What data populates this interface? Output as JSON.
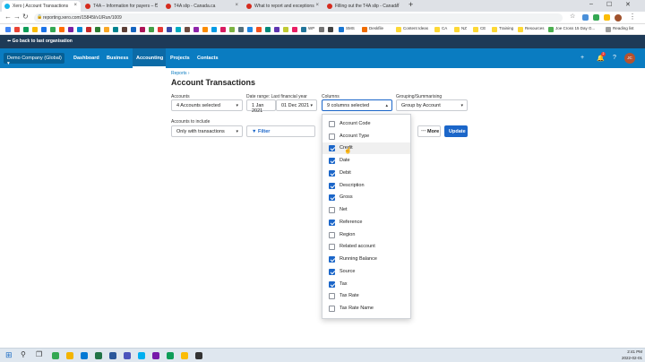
{
  "browser": {
    "tabs": [
      {
        "label": "Xero | Account Transactions",
        "active": true,
        "color": "#13b5ea"
      },
      {
        "label": "T4A – Information for payers – C",
        "active": false,
        "color": "#d52b1e"
      },
      {
        "label": "T4A slip - Canada.ca",
        "active": false,
        "color": "#d52b1e"
      },
      {
        "label": "What to report and exceptions",
        "active": false,
        "color": "#d52b1e"
      },
      {
        "label": "Filling out the T4A slip - Canada",
        "active": false,
        "color": "#d52b1e"
      }
    ],
    "new_tab": "+",
    "url": "reporting.xero.com/15845l/v1/Run/1009",
    "bookmarks": [
      "WP",
      "SMS",
      "Deskfile",
      "Content Ideas",
      "CA",
      "NZ",
      "CE",
      "Training",
      "Resources",
      "Joe Cross 15 Day G...",
      "Reading list"
    ]
  },
  "xero": {
    "back_link": "Go back to last organisation",
    "org_name": "Demo Company (Global)",
    "nav": [
      "Dashboard",
      "Business",
      "Accounting",
      "Projects",
      "Contacts"
    ],
    "avatar_text": "JC",
    "notif_count": "2"
  },
  "page": {
    "breadcrumb": "Reports ›",
    "title": "Account Transactions",
    "accounts_label": "Accounts",
    "accounts_value": "4 Accounts selected",
    "date_label": "Date range: Last financial year",
    "date_from": "1 Jan 2021",
    "date_to": "01 Dec 2021",
    "columns_label": "Columns",
    "columns_value": "9 columns selected",
    "grouping_label": "Grouping/Summarising",
    "grouping_value": "Group by Account",
    "include_label": "Accounts to include",
    "include_value": "Only with transactions",
    "filter_label": "Filter",
    "more_label": "More",
    "update_label": "Update"
  },
  "columns_options": [
    {
      "label": "Account Code",
      "checked": false
    },
    {
      "label": "Account Type",
      "checked": false
    },
    {
      "label": "Credit",
      "checked": true
    },
    {
      "label": "Date",
      "checked": true
    },
    {
      "label": "Debit",
      "checked": true
    },
    {
      "label": "Description",
      "checked": true
    },
    {
      "label": "Gross",
      "checked": true
    },
    {
      "label": "Net",
      "checked": false
    },
    {
      "label": "Reference",
      "checked": true
    },
    {
      "label": "Region",
      "checked": false
    },
    {
      "label": "Related account",
      "checked": false
    },
    {
      "label": "Running Balance",
      "checked": true
    },
    {
      "label": "Source",
      "checked": true
    },
    {
      "label": "Tax",
      "checked": true
    },
    {
      "label": "Tax Rate",
      "checked": false
    },
    {
      "label": "Tax Rate Name",
      "checked": false
    }
  ],
  "taskbar": {
    "time": "2:41 PM",
    "date": "2022-02-01"
  },
  "colors": {
    "xero_blue": "#0a7cc1",
    "xero_dark": "#1e3a57",
    "update_button": "#1b66c9",
    "checkbox": "#1b66c9"
  }
}
